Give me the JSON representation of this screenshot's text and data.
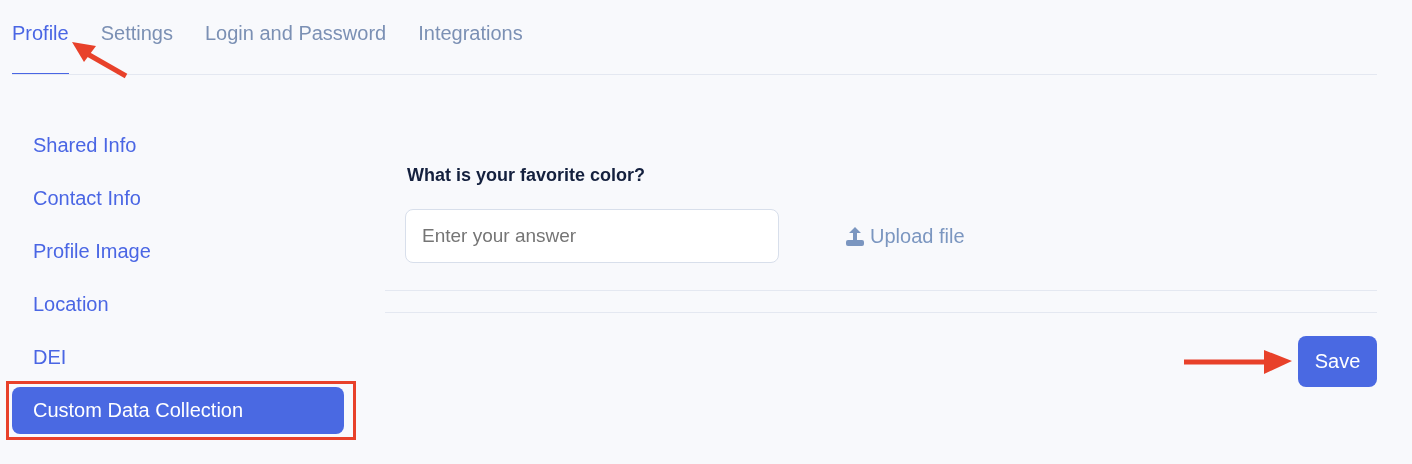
{
  "tabs": [
    {
      "label": "Profile",
      "selected": true,
      "pointed": true
    },
    {
      "label": "Settings",
      "selected": false,
      "pointed": false
    },
    {
      "label": "Login and Password",
      "selected": false,
      "pointed": false
    },
    {
      "label": "Integrations",
      "selected": false,
      "pointed": false
    }
  ],
  "sidebar": {
    "items": [
      {
        "label": "Shared Info",
        "selected": false,
        "outlined": false
      },
      {
        "label": "Contact Info",
        "selected": false,
        "outlined": false
      },
      {
        "label": "Profile Image",
        "selected": false,
        "outlined": false
      },
      {
        "label": "Location",
        "selected": false,
        "outlined": false
      },
      {
        "label": "DEI",
        "selected": false,
        "outlined": false
      },
      {
        "label": "Custom Data Collection",
        "selected": true,
        "outlined": true
      }
    ]
  },
  "form": {
    "question": "What is your favorite color?",
    "answer": {
      "placeholder": "Enter your answer"
    },
    "upload": "Upload file"
  },
  "save_button": {
    "label": "Save",
    "pointed": true
  }
}
